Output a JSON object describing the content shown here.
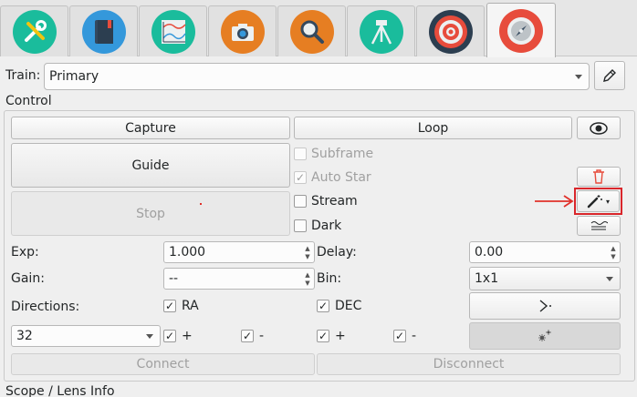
{
  "tabs": [
    {
      "icon": "tools-icon",
      "color": "#1abc9c"
    },
    {
      "icon": "book-icon",
      "color": "#3498db"
    },
    {
      "icon": "chart-icon",
      "color": "#1abc9c"
    },
    {
      "icon": "camera-icon",
      "color": "#e67e22"
    },
    {
      "icon": "search-icon",
      "color": "#e67e22"
    },
    {
      "icon": "tripod-icon",
      "color": "#1abc9c"
    },
    {
      "icon": "target-icon",
      "color": "#e74c3c"
    },
    {
      "icon": "compass-icon",
      "color": "#e74c3c",
      "active": true
    }
  ],
  "train": {
    "label": "Train:",
    "value": "Primary"
  },
  "control": {
    "title": "Control"
  },
  "buttons": {
    "capture": "Capture",
    "loop": "Loop",
    "guide": "Guide",
    "stop": "Stop",
    "connect": "Connect",
    "disconnect": "Disconnect"
  },
  "options": {
    "subframe": "Subframe",
    "auto_star": "Auto Star",
    "stream": "Stream",
    "dark": "Dark"
  },
  "fields": {
    "exp_label": "Exp:",
    "exp_value": "1.000",
    "delay_label": "Delay:",
    "delay_value": "0.00",
    "gain_label": "Gain:",
    "gain_value": "--",
    "bin_label": "Bin:",
    "bin_value": "1x1",
    "directions_label": "Directions:",
    "ra": "RA",
    "dec": "DEC",
    "pulse_value": "32",
    "plus": "+",
    "minus": "-"
  },
  "bottom": {
    "next_section": "Scope / Lens Info"
  },
  "colors": {
    "annotation": "#e0302a"
  }
}
